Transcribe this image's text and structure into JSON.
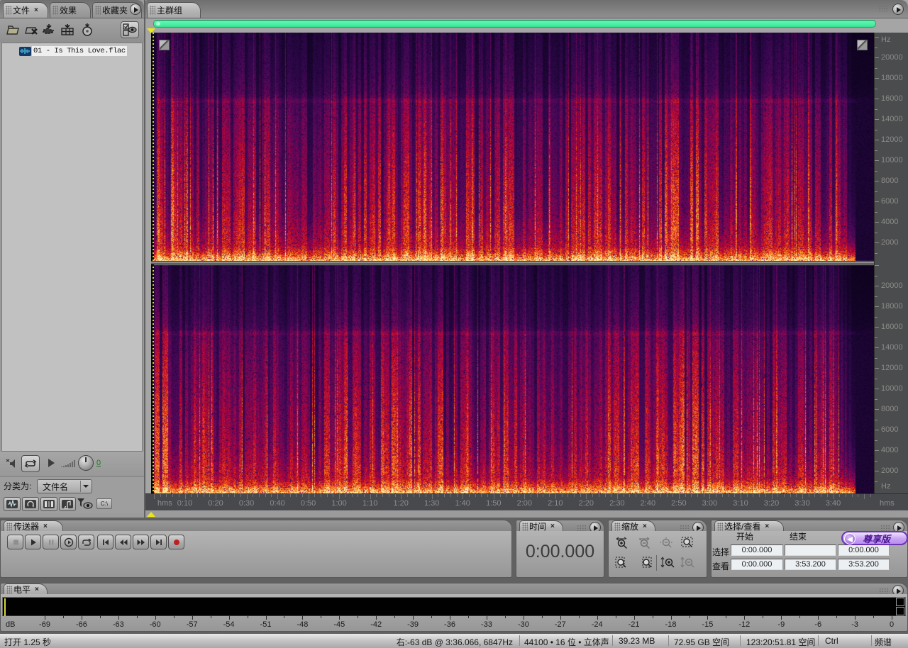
{
  "left_panel": {
    "tabs": [
      "文件",
      "效果",
      "收藏夹"
    ],
    "file_name": "01 - Is This Love.flac",
    "sort_label": "分类为:",
    "sort_value": "文件名",
    "preview_volume": "0"
  },
  "main": {
    "tab": "主群组",
    "ruler_unit": "Hz",
    "freq_labels": [
      20000,
      18000,
      16000,
      14000,
      12000,
      10000,
      8000,
      6000,
      4000,
      2000
    ],
    "timeline_unit": "hms",
    "timeline_labels": [
      "0:10",
      "0:20",
      "0:30",
      "0:40",
      "0:50",
      "1:00",
      "1:10",
      "1:20",
      "1:30",
      "1:40",
      "1:50",
      "2:00",
      "2:10",
      "2:20",
      "2:30",
      "2:40",
      "2:50",
      "3:00",
      "3:10",
      "3:20",
      "3:30",
      "3:40"
    ],
    "duration_sec": 233.2,
    "accent_scrollbar_color": "#4cf1a5"
  },
  "transport": {
    "title": "传送器"
  },
  "time_panel": {
    "title": "时间",
    "value": "0:00.000"
  },
  "zoom_panel": {
    "title": "缩放"
  },
  "selection_panel": {
    "title": "选择/查看",
    "col_start": "开始",
    "col_end": "结束",
    "row_selection": "选择",
    "row_view": "查看",
    "selection": {
      "start": "0:00.000",
      "end": "",
      "length": "0:00.000"
    },
    "view": {
      "start": "0:00.000",
      "end": "3:53.200",
      "length": "3:53.200"
    },
    "badge": "尊享版"
  },
  "levels_panel": {
    "title": "电平",
    "unit": "dB",
    "db_labels": [
      -69,
      -66,
      -63,
      -60,
      -57,
      -54,
      -51,
      -48,
      -45,
      -42,
      -39,
      -36,
      -33,
      -30,
      -27,
      -24,
      -21,
      -18,
      -15,
      -12,
      -9,
      -6,
      -3,
      0
    ]
  },
  "status_bar": {
    "open_time": "打开 1.25 秒",
    "hover_info": "右:-63 dB @ 3:36.066, 6847Hz",
    "format": "44100 • 16 位 • 立体声",
    "file_size": "39.23 MB",
    "disk_free": "72.95 GB 空间",
    "time_free": "123:20:51.81 空间",
    "modifier": "Ctrl",
    "view_mode": "频谱"
  }
}
